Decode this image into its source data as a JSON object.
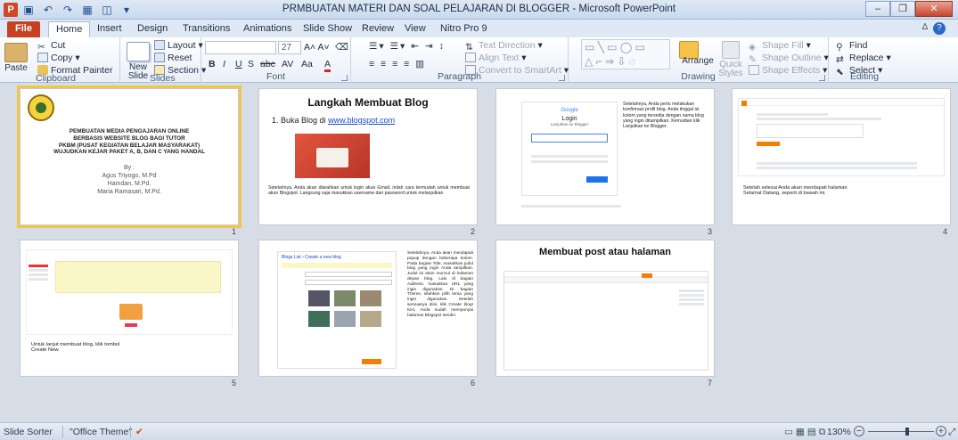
{
  "window": {
    "title": "PRMBUATAN MATERI DAN SOAL PELAJARAN DI BLOGGER  -  Microsoft PowerPoint",
    "app_icon_letter": "P"
  },
  "tabs": [
    "File",
    "Home",
    "Insert",
    "Design",
    "Transitions",
    "Animations",
    "Slide Show",
    "Review",
    "View",
    "Nitro Pro 9"
  ],
  "ribbon": {
    "clipboard": {
      "label": "Clipboard",
      "paste": "Paste",
      "cut": "Cut",
      "copy": "Copy",
      "format_painter": "Format Painter"
    },
    "slides": {
      "label": "Slides",
      "new_slide": "New Slide",
      "layout": "Layout",
      "reset": "Reset",
      "section": "Section"
    },
    "font": {
      "label": "Font",
      "size": "27",
      "bold": "B",
      "italic": "I",
      "underline": "U",
      "strike": "S",
      "shadow": "abc",
      "spacing": "AV",
      "case": "Aa",
      "color": "A"
    },
    "paragraph": {
      "label": "Paragraph",
      "text_direction": "Text Direction",
      "align_text": "Align Text",
      "smartart": "Convert to SmartArt"
    },
    "drawing": {
      "label": "Drawing",
      "arrange": "Arrange",
      "quick_styles": "Quick Styles",
      "shape_fill": "Shape Fill",
      "shape_outline": "Shape Outline",
      "shape_effects": "Shape Effects"
    },
    "editing": {
      "label": "Editing",
      "find": "Find",
      "replace": "Replace",
      "select": "Select"
    }
  },
  "slides": [
    {
      "num": "1",
      "lines": [
        "PEMBUATAN MEDIA PENGAJARAN ONLINE",
        "BERBASIS WEBSITE BLOG BAGI TUTOR",
        "PKBM (PUSAT KEGIATAN BELAJAR MASYARAKAT)",
        "WUJUDKAN KEJAR PAKET A, B, DAN C YANG HANDAL"
      ],
      "by": "By :",
      "authors": [
        "Agus Triyogo, M.Pd",
        "Hamdan, M.Pd.",
        "Maria Ramasari, M.Pd."
      ]
    },
    {
      "num": "2",
      "title": "Langkah Membuat Blog",
      "item": "Buka Blog di",
      "link": "www.blogspot.com",
      "caption": "Setelahnya, Anda akan diarahkan untuk login akun Gmail, inilah cara termudah untuk membuat akun Blogspot. Langsung saja masukkan username dan password untuk melanjutkan"
    },
    {
      "num": "3",
      "google": "Google",
      "login": "Login",
      "sub": "Lanjutkan ke Blogger",
      "caption": "Setelahnya, Anda perlu melakukan konfirmasi profil blog. Anda tinggal isi kolom yang tersedia dengan nama blog yang ingin ditampilkan. Kemudian klik Lanjutkan ke Blogger."
    },
    {
      "num": "4",
      "caption": "Setelah selesai Anda akan mendapati halaman Selamat Datang, seperti di bawah ini."
    },
    {
      "num": "5",
      "caption": "Untuk lanjut membuat blog, klik tombol Create New."
    },
    {
      "num": "6",
      "dialog_title": "Blogs List › Create a new blog",
      "caption": "Setelahnya, Anda akan mendapati popup dengan beberapa kolom. Pada bagian Title, masukkan judul blog yang ingin Anda tampilkan. Judul ini akan muncul di halaman depan blog. Lalu di bagian Address, masukkan URL yang ingin digunakan. Di bagian Theme, silahkan pilih tema yang ingin digunakan. Setelah semuanya diisi, klik Create blog! Kini, Anda sudah mempunyai halaman Blogspot sendiri."
    },
    {
      "num": "7",
      "title": "Membuat post atau halaman"
    }
  ],
  "status": {
    "view": "Slide Sorter",
    "theme": "\"Office Theme\"",
    "zoom": "130%"
  },
  "colors": {
    "file_tab": "#c8401f",
    "selected_outline": "#f3c64b",
    "blogger_orange": "#f57d00"
  }
}
